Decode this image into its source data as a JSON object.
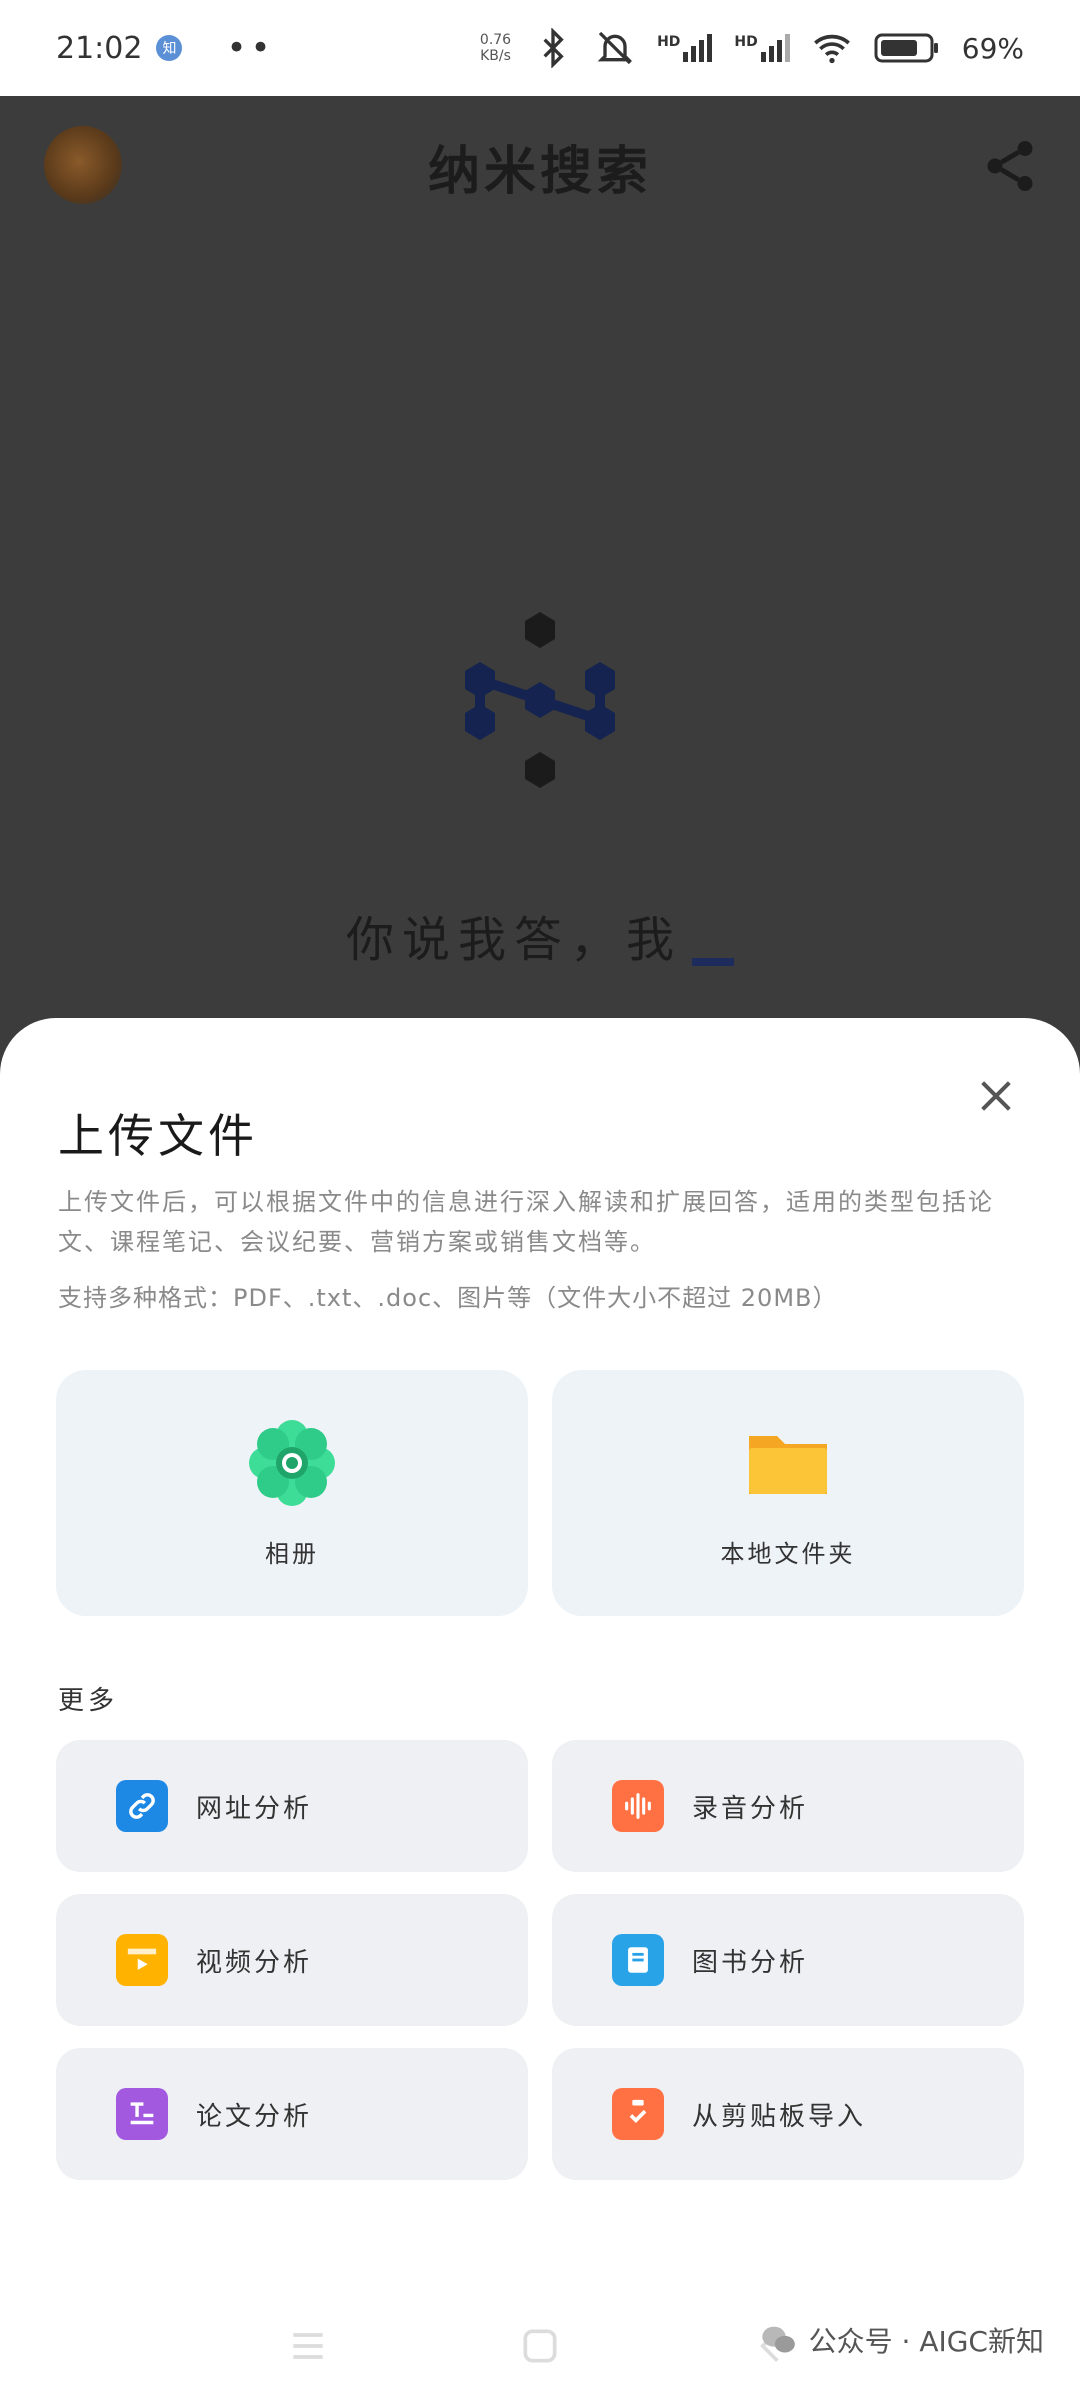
{
  "status_bar": {
    "time": "21:02",
    "badge": "知",
    "dots": "••",
    "net_speed_value": "0.76",
    "net_speed_unit": "KB/s",
    "signal_1_label": "HD",
    "signal_2_label": "HD",
    "battery_percent": "69%"
  },
  "header": {
    "title": "纳米搜索"
  },
  "hero": {
    "slogan": "你说我答，我"
  },
  "upload_sheet": {
    "title": "上传文件",
    "description": "上传文件后，可以根据文件中的信息进行深入解读和扩展回答，适用的类型包括论文、课程笔记、会议纪要、营销方案或销售文档等。",
    "formats": "支持多种格式：PDF、.txt、.doc、图片等（文件大小不超过 20MB）",
    "primary_options": [
      {
        "label": "相册",
        "icon": "photo-album-icon"
      },
      {
        "label": "本地文件夹",
        "icon": "folder-icon"
      }
    ],
    "more_label": "更多",
    "more_options": [
      {
        "label": "网址分析",
        "icon": "link-icon",
        "color": "#1e88e5"
      },
      {
        "label": "录音分析",
        "icon": "audio-icon",
        "color": "#ff7043"
      },
      {
        "label": "视频分析",
        "icon": "video-icon",
        "color": "#ffb300"
      },
      {
        "label": "图书分析",
        "icon": "book-icon",
        "color": "#29a3e8"
      },
      {
        "label": "论文分析",
        "icon": "paper-icon",
        "color": "#a259e0"
      },
      {
        "label": "从剪贴板导入",
        "icon": "clipboard-icon",
        "color": "#ff7043"
      }
    ]
  },
  "watermark": {
    "text": "公众号 · AIGC新知"
  }
}
